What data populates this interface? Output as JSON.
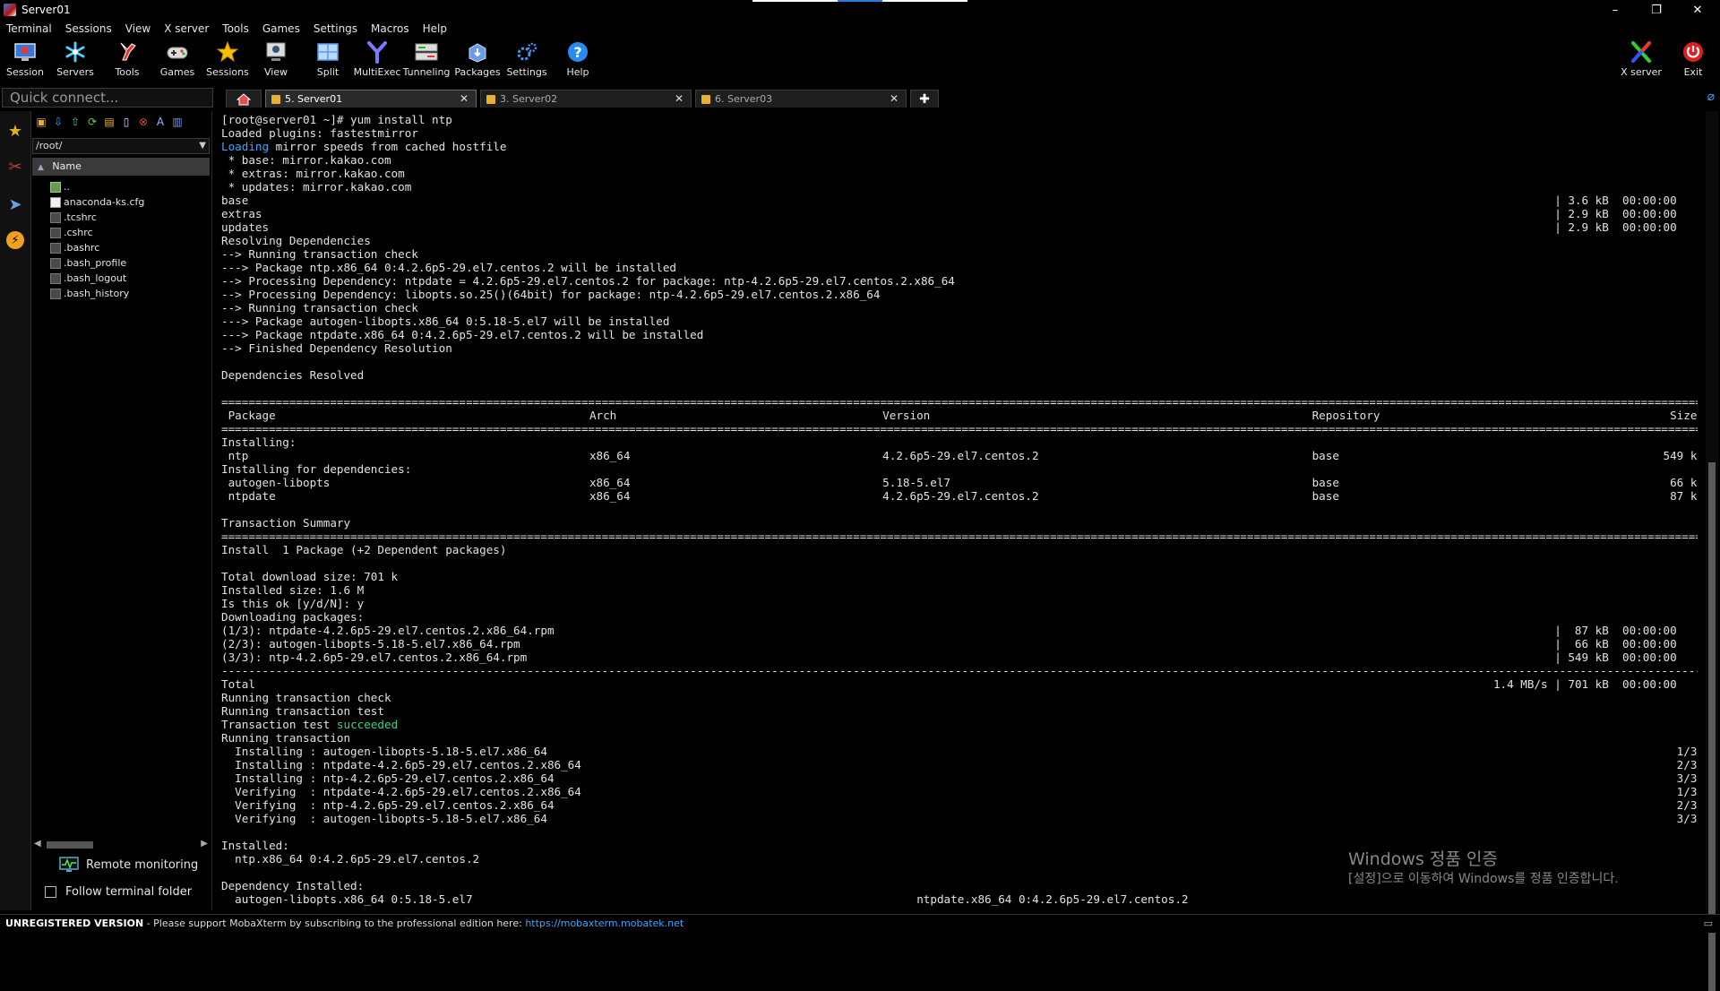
{
  "window": {
    "title": "Server01",
    "controls": [
      "–",
      "❐",
      "✕"
    ]
  },
  "menubar": [
    "Terminal",
    "Sessions",
    "View",
    "X server",
    "Tools",
    "Games",
    "Settings",
    "Macros",
    "Help"
  ],
  "toolbar": {
    "left": [
      {
        "label": "Session",
        "icon": "session-icon"
      },
      {
        "label": "Servers",
        "icon": "servers-icon"
      },
      {
        "label": "Tools",
        "icon": "tools-icon"
      },
      {
        "label": "Games",
        "icon": "games-icon"
      },
      {
        "label": "Sessions",
        "icon": "sessions-star-icon"
      },
      {
        "label": "View",
        "icon": "view-icon"
      },
      {
        "label": "Split",
        "icon": "split-icon"
      },
      {
        "label": "MultiExec",
        "icon": "multiexec-icon"
      },
      {
        "label": "Tunneling",
        "icon": "tunneling-icon"
      },
      {
        "label": "Packages",
        "icon": "packages-icon"
      },
      {
        "label": "Settings",
        "icon": "settings-icon"
      },
      {
        "label": "Help",
        "icon": "help-icon"
      }
    ],
    "right": [
      {
        "label": "X server",
        "icon": "xserver-icon"
      },
      {
        "label": "Exit",
        "icon": "exit-icon"
      }
    ]
  },
  "quick_connect": {
    "placeholder": "Quick connect..."
  },
  "tabs": [
    {
      "label": "5. Server01",
      "active": true
    },
    {
      "label": "3. Server02",
      "active": false
    },
    {
      "label": "6. Server03",
      "active": false
    }
  ],
  "sidebar": {
    "path": "/root/",
    "column_header": "Name",
    "files": [
      "..",
      "anaconda-ks.cfg",
      ".tcshrc",
      ".cshrc",
      ".bashrc",
      ".bash_profile",
      ".bash_logout",
      ".bash_history"
    ],
    "remote_monitoring": "Remote monitoring",
    "follow_terminal_folder": "Follow terminal folder"
  },
  "terminal": {
    "lines": [
      {
        "text": "[root@server01 ~]# yum install ntp"
      },
      {
        "text": "Loaded plugins: fastestmirror"
      },
      {
        "text": "Loading",
        "rest": " mirror speeds from cached hostfile",
        "color": "blue"
      },
      {
        "text": " * base: mirror.kakao.com"
      },
      {
        "text": " * extras: mirror.kakao.com"
      },
      {
        "text": " * updates: mirror.kakao.com"
      },
      {
        "text": "base",
        "right": "| 3.6 kB  00:00:00    "
      },
      {
        "text": "extras",
        "right": "| 2.9 kB  00:00:00    "
      },
      {
        "text": "updates",
        "right": "| 2.9 kB  00:00:00    "
      },
      {
        "text": "Resolving Dependencies"
      },
      {
        "text": "--> Running transaction check"
      },
      {
        "text": "---> Package ntp.x86_64 0:4.2.6p5-29.el7.centos.2 will be installed"
      },
      {
        "text": "--> Processing Dependency: ntpdate = 4.2.6p5-29.el7.centos.2 for package: ntp-4.2.6p5-29.el7.centos.2.x86_64"
      },
      {
        "text": "--> Processing Dependency: libopts.so.25()(64bit) for package: ntp-4.2.6p5-29.el7.centos.2.x86_64"
      },
      {
        "text": "--> Running transaction check"
      },
      {
        "text": "---> Package autogen-libopts.x86_64 0:5.18-5.el7 will be installed"
      },
      {
        "text": "---> Package ntpdate.x86_64 0:4.2.6p5-29.el7.centos.2 will be installed"
      },
      {
        "text": "--> Finished Dependency Resolution"
      },
      {
        "text": ""
      },
      {
        "text": "Dependencies Resolved"
      },
      {
        "text": ""
      },
      {
        "text": "",
        "rule": "="
      },
      {
        "text": " Package",
        "cols": [
          "Arch",
          "Version",
          "Repository"
        ],
        "right": "Size "
      },
      {
        "text": "",
        "rule": "="
      },
      {
        "text": "Installing:"
      },
      {
        "text": " ntp",
        "cols": [
          "x86_64",
          "4.2.6p5-29.el7.centos.2",
          "base"
        ],
        "right": "549 k "
      },
      {
        "text": "Installing for dependencies:"
      },
      {
        "text": " autogen-libopts",
        "cols": [
          "x86_64",
          "5.18-5.el7",
          "base"
        ],
        "right": "66 k "
      },
      {
        "text": " ntpdate",
        "cols": [
          "x86_64",
          "4.2.6p5-29.el7.centos.2",
          "base"
        ],
        "right": "87 k "
      },
      {
        "text": ""
      },
      {
        "text": "Transaction Summary"
      },
      {
        "text": "",
        "rule": "="
      },
      {
        "text": "Install  1 Package (+2 Dependent packages)"
      },
      {
        "text": ""
      },
      {
        "text": "Total download size: 701 k"
      },
      {
        "text": "Installed size: 1.6 M"
      },
      {
        "text": "Is this ok [y/d/N]: y"
      },
      {
        "text": "Downloading packages:"
      },
      {
        "text": "(1/3): ntpdate-4.2.6p5-29.el7.centos.2.x86_64.rpm",
        "right": "|  87 kB  00:00:00    "
      },
      {
        "text": "(2/3): autogen-libopts-5.18-5.el7.x86_64.rpm",
        "right": "|  66 kB  00:00:00    "
      },
      {
        "text": "(3/3): ntp-4.2.6p5-29.el7.centos.2.x86_64.rpm",
        "right": "| 549 kB  00:00:00    "
      },
      {
        "text": "",
        "rule": "-"
      },
      {
        "text": "Total",
        "right": "1.4 MB/s | 701 kB  00:00:00    "
      },
      {
        "text": "Running transaction check"
      },
      {
        "text": "Running transaction test"
      },
      {
        "text": "Transaction test ",
        "rest": "succeeded",
        "color": "green"
      },
      {
        "text": "Running transaction"
      },
      {
        "text": "  Installing : autogen-libopts-5.18-5.el7.x86_64",
        "right": "1/3 "
      },
      {
        "text": "  Installing : ntpdate-4.2.6p5-29.el7.centos.2.x86_64",
        "right": "2/3 "
      },
      {
        "text": "  Installing : ntp-4.2.6p5-29.el7.centos.2.x86_64",
        "right": "3/3 "
      },
      {
        "text": "  Verifying  : ntpdate-4.2.6p5-29.el7.centos.2.x86_64",
        "right": "1/3 "
      },
      {
        "text": "  Verifying  : ntp-4.2.6p5-29.el7.centos.2.x86_64",
        "right": "2/3 "
      },
      {
        "text": "  Verifying  : autogen-libopts-5.18-5.el7.x86_64",
        "right": "3/3 "
      },
      {
        "text": ""
      },
      {
        "text": "Installed:"
      },
      {
        "text": "  ntp.x86_64 0:4.2.6p5-29.el7.centos.2"
      },
      {
        "text": ""
      },
      {
        "text": "Dependency Installed:"
      },
      {
        "text": "  autogen-libopts.x86_64 0:5.18-5.el7",
        "cols2": "ntpdate.x86_64 0:4.2.6p5-29.el7.centos.2"
      }
    ]
  },
  "watermark": {
    "line1": "Windows 정품 인증",
    "line2": "[설정]으로 이동하여 Windows를 정품 인증합니다."
  },
  "statusbar": {
    "bold": "UNREGISTERED VERSION",
    "text": "  -  Please support MobaXterm by subscribing to the professional edition here:  ",
    "link": "https://mobaxterm.mobatek.net"
  },
  "colors": {
    "accent_blue": "#3fa6ff",
    "success_green": "#38d28a",
    "exit_red": "#e02020"
  }
}
